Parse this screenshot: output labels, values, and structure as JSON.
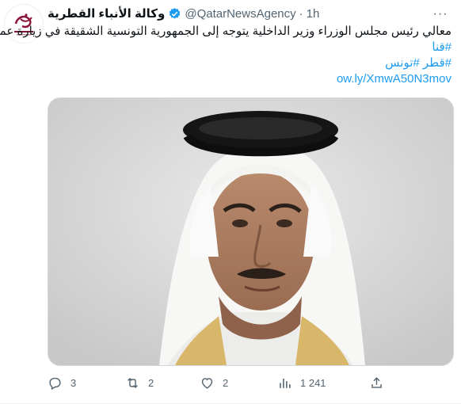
{
  "tweet": {
    "display_name": "وكالة الأنباء القطرية",
    "handle": "@QatarNewsAgency",
    "separator": "·",
    "time": "1h",
    "text_line1": "معالي رئيس مجلس الوزراء وزير الداخلية يتوجه إلى الجمهورية التونسية الشقيقة في زيارة عمل",
    "hashtag1": "#قنا",
    "hashtag2": "#قطر #تونس",
    "short_link": "ow.ly/XmwA50N3mov",
    "more_label": "···"
  },
  "actions": {
    "replies": "3",
    "retweets": "2",
    "likes": "2",
    "views": "1 241"
  },
  "colors": {
    "accent": "#1d9bf0",
    "muted": "#536471",
    "brand": "#8a1538"
  },
  "icons": [
    "verified-badge-icon",
    "more-icon",
    "reply-icon",
    "retweet-icon",
    "like-icon",
    "views-icon",
    "share-icon"
  ]
}
